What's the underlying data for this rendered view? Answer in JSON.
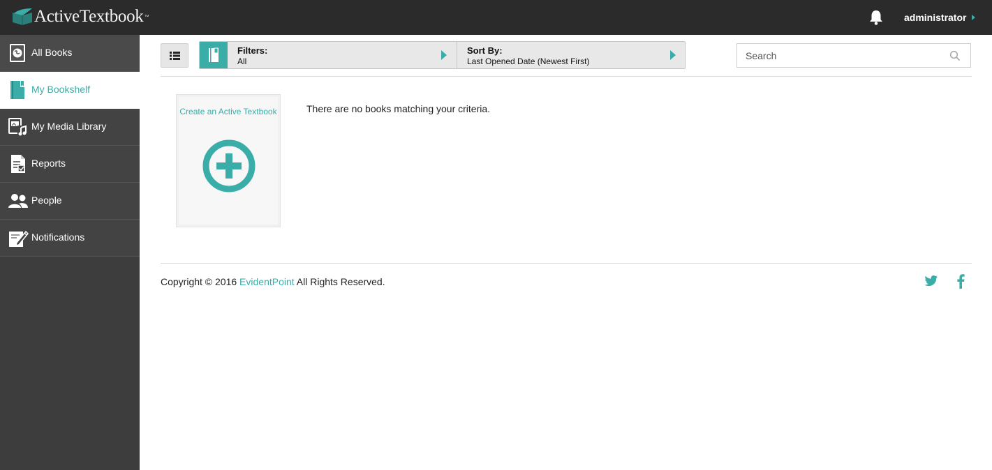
{
  "header": {
    "logo_text": "ActiveTextbook",
    "logo_tm": "™",
    "username": "administrator",
    "icons": {
      "logo": "book-leaf-logo-icon",
      "bell": "bell-icon",
      "user_caret": "caret-right-icon"
    }
  },
  "sidebar": {
    "items": [
      {
        "label": "All Books",
        "icon": "globe-book-icon",
        "active": false
      },
      {
        "label": "My Bookshelf",
        "icon": "bookshelf-icon",
        "active": true
      },
      {
        "label": "My Media Library",
        "icon": "media-library-icon",
        "active": false
      },
      {
        "label": "Reports",
        "icon": "report-icon",
        "active": false
      },
      {
        "label": "People",
        "icon": "people-icon",
        "active": false
      },
      {
        "label": "Notifications",
        "icon": "notifications-icon",
        "active": false
      }
    ]
  },
  "toolbar": {
    "filters_title": "Filters:",
    "filters_value": "All",
    "sort_title": "Sort By:",
    "sort_value": "Last Opened Date (Newest First)",
    "search_placeholder": "Search"
  },
  "content": {
    "create_label": "Create an Active Textbook",
    "empty_message": "There are no books matching your criteria."
  },
  "footer": {
    "copyright_prefix": "Copyright © 2016 ",
    "company": "EvidentPoint",
    "copyright_suffix": " All Rights Reserved."
  },
  "colors": {
    "accent": "#3aada8",
    "topbar": "#2b2b2b",
    "sidebar": "#3d3d3d"
  }
}
